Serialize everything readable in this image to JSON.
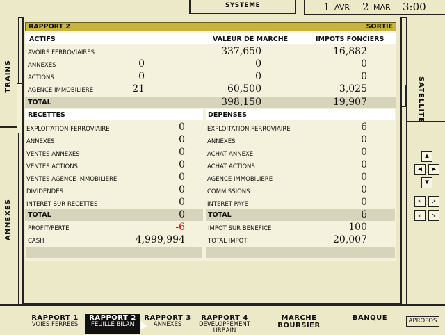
{
  "top": {
    "system_menu": "SYSTEME",
    "date": {
      "day1": "1",
      "month1": "AVR",
      "day2": "2",
      "month2": "MAR",
      "time": "3:00"
    }
  },
  "side": {
    "left_top": "TRAINS",
    "left_bottom": "ANNEXES",
    "right_top": "SATELLITE"
  },
  "report": {
    "title": "RAPPORT 2",
    "exit": "SORTIE",
    "actifs": {
      "header": "ACTIFS",
      "col_market": "VALEUR DE MARCHE",
      "col_tax": "IMPOTS FONCIERS",
      "rows": [
        {
          "label": "AVOIRS FERROVIAIRES",
          "count": "",
          "market": "337,650",
          "tax": "16,882"
        },
        {
          "label": "ANNEXES",
          "count": "0",
          "market": "0",
          "tax": "0"
        },
        {
          "label": "ACTIONS",
          "count": "0",
          "market": "0",
          "tax": "0"
        },
        {
          "label": "AGENCE IMMOBILIERE",
          "count": "21",
          "market": "60,500",
          "tax": "3,025"
        }
      ],
      "total_label": "TOTAL",
      "total_market": "398,150",
      "total_tax": "19,907"
    },
    "recettes": {
      "header": "RECETTES",
      "rows": [
        {
          "label": "EXPLOITATION FERROVIAIRE",
          "value": "0"
        },
        {
          "label": "ANNEXES",
          "value": "0"
        },
        {
          "label": "VENTES ANNEXES",
          "value": "0"
        },
        {
          "label": "VENTES ACTIONS",
          "value": "0"
        },
        {
          "label": "VENTES AGENCE IMMOBILIERE",
          "value": "0"
        },
        {
          "label": "DIVIDENDES",
          "value": "0"
        },
        {
          "label": "INTERET SUR RECETTES",
          "value": "0"
        }
      ],
      "total_label": "TOTAL",
      "total_value": "0",
      "profit_label": "PROFIT/PERTE",
      "profit_value": "-6",
      "cash_label": "CASH",
      "cash_value": "4,999,994"
    },
    "depenses": {
      "header": "DEPENSES",
      "rows": [
        {
          "label": "EXPLOITATION FERROVIAIRE",
          "value": "6"
        },
        {
          "label": "ANNEXES",
          "value": "0"
        },
        {
          "label": "ACHAT ANNEXE",
          "value": "0"
        },
        {
          "label": "ACHAT ACTIONS",
          "value": "0"
        },
        {
          "label": "AGENCE IMMOBILIERE",
          "value": "0"
        },
        {
          "label": "COMMISSIONS",
          "value": "0"
        },
        {
          "label": "INTERET PAYE",
          "value": "0"
        }
      ],
      "total_label": "TOTAL",
      "total_value": "6",
      "tax_label": "IMPOT SUR BENEFICE",
      "tax_value": "100",
      "total_tax_label": "TOTAL IMPOT",
      "total_tax_value": "20,007"
    }
  },
  "tabs": [
    {
      "label": "RAPPORT 1",
      "sub": "VOIES FERREES",
      "sub2": ""
    },
    {
      "label": "RAPPORT 2",
      "sub": "FEUILLE BILAN",
      "sub2": ""
    },
    {
      "label": "RAPPORT 3",
      "sub": "ANNEXES",
      "sub2": ""
    },
    {
      "label": "RAPPORT 4",
      "sub": "DEVELOPPEMENT",
      "sub2": "URBAIN"
    },
    {
      "label": "MARCHE BOURSIER",
      "sub": "",
      "sub2": ""
    },
    {
      "label": "BANQUE",
      "sub": "",
      "sub2": ""
    }
  ],
  "apropos": "APROPOS",
  "colors": {
    "title_bar": "#c8b43a",
    "negative": "#b01010",
    "active_tab": "#111111"
  }
}
